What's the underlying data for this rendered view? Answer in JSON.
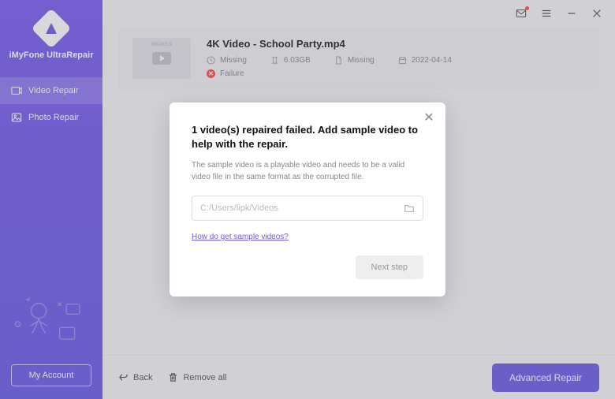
{
  "brand": {
    "name": "iMyFone UltraRepair"
  },
  "sidebar": {
    "items": [
      {
        "label": "Video Repair"
      },
      {
        "label": "Photo Repair"
      }
    ],
    "account": "My Account"
  },
  "file": {
    "name": "4K Video - School Party.mp4",
    "meta": {
      "duration": "Missing",
      "size": "6.03GB",
      "format": "Missing",
      "date": "2022-04-14"
    },
    "status": "Failure"
  },
  "footer": {
    "back": "Back",
    "remove_all": "Remove all",
    "advanced": "Advanced Repair"
  },
  "modal": {
    "title": "1 video(s) repaired failed. Add sample video to help with the repair.",
    "description": "The sample video is a playable video and needs to be a valid video file in the same format as the corrupted file.",
    "placeholder": "C:/Users/lipk/Videos",
    "help_link": "How do get sample videos?",
    "next": "Next step"
  }
}
